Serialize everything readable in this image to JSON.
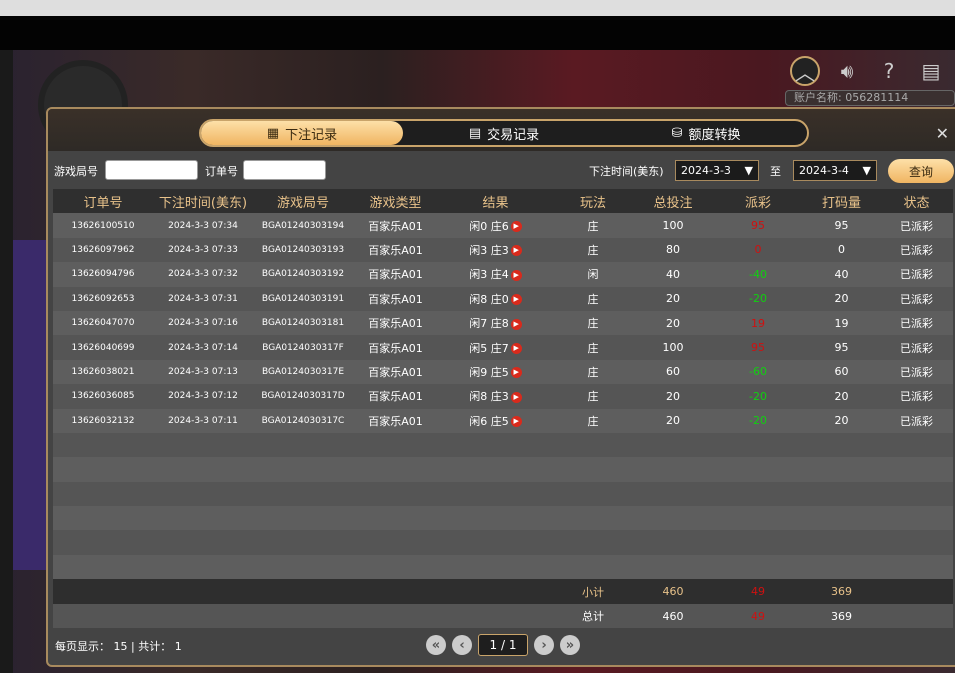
{
  "account_label": "账户名称: 056281114",
  "tabs": [
    {
      "label": "下注记录",
      "icon": "calendar-icon"
    },
    {
      "label": "交易记录",
      "icon": "clipboard-icon"
    },
    {
      "label": "额度转换",
      "icon": "coins-icon"
    }
  ],
  "filter": {
    "game_no_label": "游戏局号",
    "order_no_label": "订单号",
    "game_no_value": "",
    "order_no_value": "",
    "time_label": "下注时间(美东)",
    "from": "2024-3-3",
    "to_label": "至",
    "to": "2024-3-4",
    "query": "查询"
  },
  "columns": [
    "订单号",
    "下注时间(美东)",
    "游戏局号",
    "游戏类型",
    "结果",
    "玩法",
    "总投注",
    "派彩",
    "打码量",
    "状态"
  ],
  "rows": [
    [
      "13626100510",
      "2024-3-3 07:34",
      "BGA01240303194",
      "百家乐A01",
      "闲0 庄6",
      "庄",
      "100",
      "95",
      "95",
      "已派彩"
    ],
    [
      "13626097962",
      "2024-3-3 07:33",
      "BGA01240303193",
      "百家乐A01",
      "闲3 庄3",
      "庄",
      "80",
      "0",
      "0",
      "已派彩"
    ],
    [
      "13626094796",
      "2024-3-3 07:32",
      "BGA01240303192",
      "百家乐A01",
      "闲3 庄4",
      "闲",
      "40",
      "-40",
      "40",
      "已派彩"
    ],
    [
      "13626092653",
      "2024-3-3 07:31",
      "BGA01240303191",
      "百家乐A01",
      "闲8 庄0",
      "庄",
      "20",
      "-20",
      "20",
      "已派彩"
    ],
    [
      "13626047070",
      "2024-3-3 07:16",
      "BGA01240303181",
      "百家乐A01",
      "闲7 庄8",
      "庄",
      "20",
      "19",
      "19",
      "已派彩"
    ],
    [
      "13626040699",
      "2024-3-3 07:14",
      "BGA0124030317F",
      "百家乐A01",
      "闲5 庄7",
      "庄",
      "100",
      "95",
      "95",
      "已派彩"
    ],
    [
      "13626038021",
      "2024-3-3 07:13",
      "BGA0124030317E",
      "百家乐A01",
      "闲9 庄5",
      "庄",
      "60",
      "-60",
      "60",
      "已派彩"
    ],
    [
      "13626036085",
      "2024-3-3 07:12",
      "BGA0124030317D",
      "百家乐A01",
      "闲8 庄3",
      "庄",
      "20",
      "-20",
      "20",
      "已派彩"
    ],
    [
      "13626032132",
      "2024-3-3 07:11",
      "BGA0124030317C",
      "百家乐A01",
      "闲6 庄5",
      "庄",
      "20",
      "-20",
      "20",
      "已派彩"
    ]
  ],
  "subtotal": {
    "label": "小计",
    "bet": "460",
    "payout": "49",
    "turnover": "369"
  },
  "total": {
    "label": "总计",
    "bet": "460",
    "payout": "49",
    "turnover": "369"
  },
  "footer": {
    "per_page_label": "每页显示：",
    "per_page": "15",
    "sep": "|",
    "count_label": "共计：",
    "count": "1",
    "page": "1 / 1"
  },
  "colors": {
    "win": "#d01010",
    "loss": "#10d010",
    "accent": "#f0b562"
  }
}
